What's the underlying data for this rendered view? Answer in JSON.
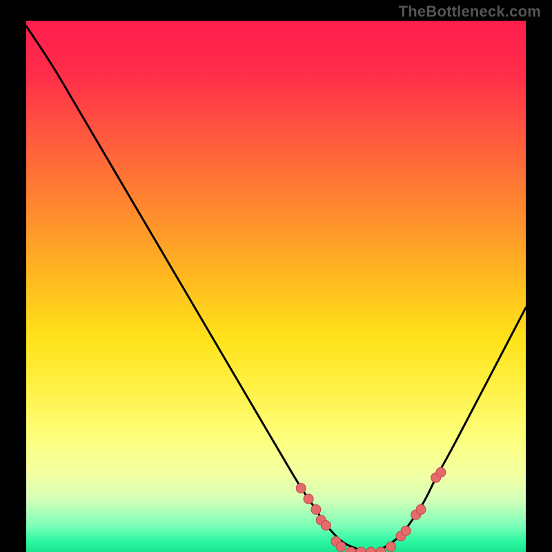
{
  "attribution": "TheBottleneck.com",
  "colors": {
    "background": "#000000",
    "curve_stroke": "#000000",
    "point_fill": "#e66a6a",
    "point_stroke": "#b94a4a",
    "gradient_top": "#ff1d4c",
    "gradient_bottom": "#1de38f"
  },
  "chart_data": {
    "type": "line",
    "title": "",
    "xlabel": "",
    "ylabel": "",
    "xlim": [
      0,
      100
    ],
    "ylim": [
      0,
      100
    ],
    "x": [
      0,
      5,
      10,
      15,
      20,
      25,
      30,
      35,
      40,
      45,
      50,
      55,
      58,
      60,
      63,
      65,
      68,
      70,
      72,
      75,
      78,
      80,
      82,
      85,
      90,
      95,
      100
    ],
    "values": [
      99,
      92,
      84,
      76,
      68,
      60,
      52,
      44,
      36,
      28,
      20,
      12,
      8,
      5,
      2,
      1,
      0,
      0,
      1,
      3,
      7,
      10,
      14,
      19,
      28,
      37,
      46
    ],
    "points": [
      {
        "x": 55,
        "y": 12
      },
      {
        "x": 56.5,
        "y": 10
      },
      {
        "x": 58,
        "y": 8
      },
      {
        "x": 59,
        "y": 6
      },
      {
        "x": 60,
        "y": 5
      },
      {
        "x": 62,
        "y": 2
      },
      {
        "x": 63,
        "y": 1
      },
      {
        "x": 65,
        "y": 0
      },
      {
        "x": 67,
        "y": 0
      },
      {
        "x": 69,
        "y": 0
      },
      {
        "x": 71,
        "y": 0
      },
      {
        "x": 73,
        "y": 1
      },
      {
        "x": 75,
        "y": 3
      },
      {
        "x": 76,
        "y": 4
      },
      {
        "x": 78,
        "y": 7
      },
      {
        "x": 79,
        "y": 8
      },
      {
        "x": 82,
        "y": 14
      },
      {
        "x": 83,
        "y": 15
      }
    ]
  }
}
